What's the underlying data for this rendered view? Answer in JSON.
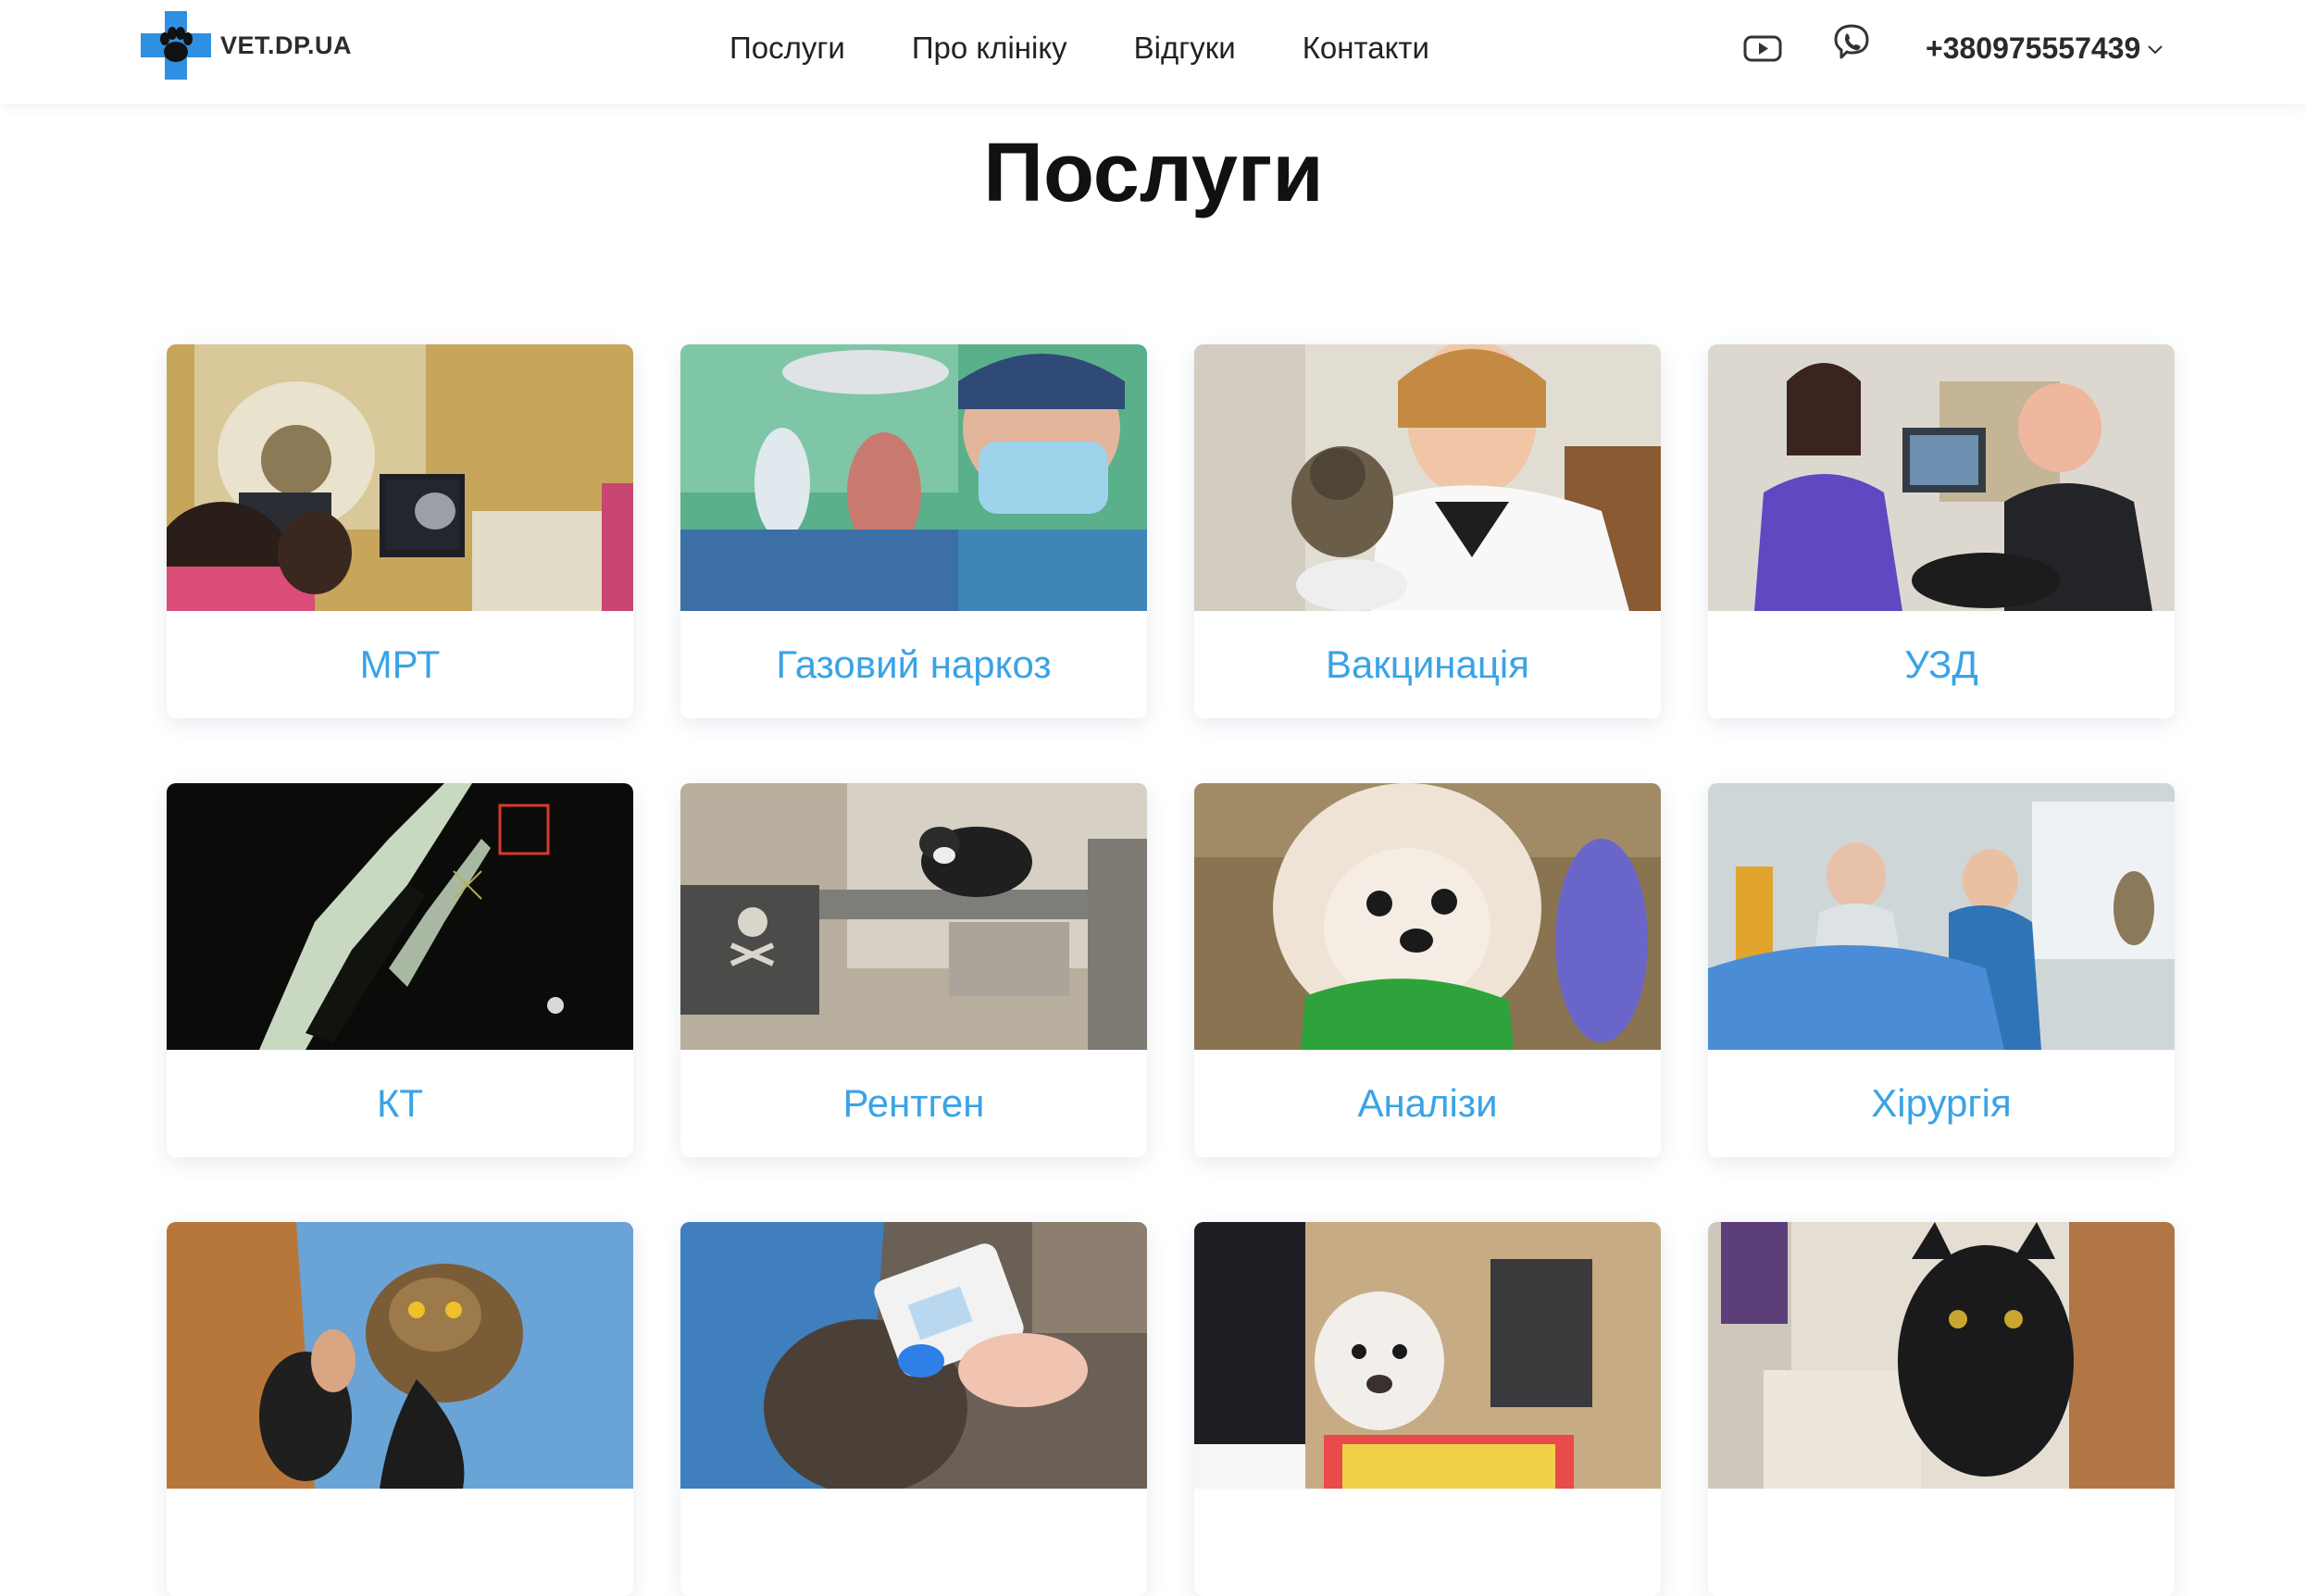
{
  "header": {
    "logo_text": "VET.DP.UA",
    "nav": [
      "Послуги",
      "Про клініку",
      "Відгуки",
      "Контакти"
    ],
    "phone": "+380975557439",
    "social_icons": [
      "youtube-icon",
      "viber-icon"
    ]
  },
  "main": {
    "title": "Послуги",
    "services": [
      {
        "label": "МРТ",
        "image": "mri-room-photo"
      },
      {
        "label": "Газовий наркоз",
        "image": "surgeon-mask-photo"
      },
      {
        "label": "Вакцинація",
        "image": "vet-with-monkey-photo"
      },
      {
        "label": "УЗД",
        "image": "ultrasound-team-photo"
      },
      {
        "label": "КТ",
        "image": "ct-scan-photo"
      },
      {
        "label": "Рентген",
        "image": "cat-xray-photo"
      },
      {
        "label": "Аналізи",
        "image": "pomeranian-photo"
      },
      {
        "label": "Хірургія",
        "image": "surgery-team-photo"
      },
      {
        "label": "",
        "image": "owl-photo"
      },
      {
        "label": "",
        "image": "cat-scanner-photo"
      },
      {
        "label": "",
        "image": "white-dog-photo"
      },
      {
        "label": "",
        "image": "black-cat-photo"
      }
    ]
  },
  "colors": {
    "accent": "#3aa3e6",
    "logo_blue": "#2f8fe0",
    "title": "#111111"
  }
}
